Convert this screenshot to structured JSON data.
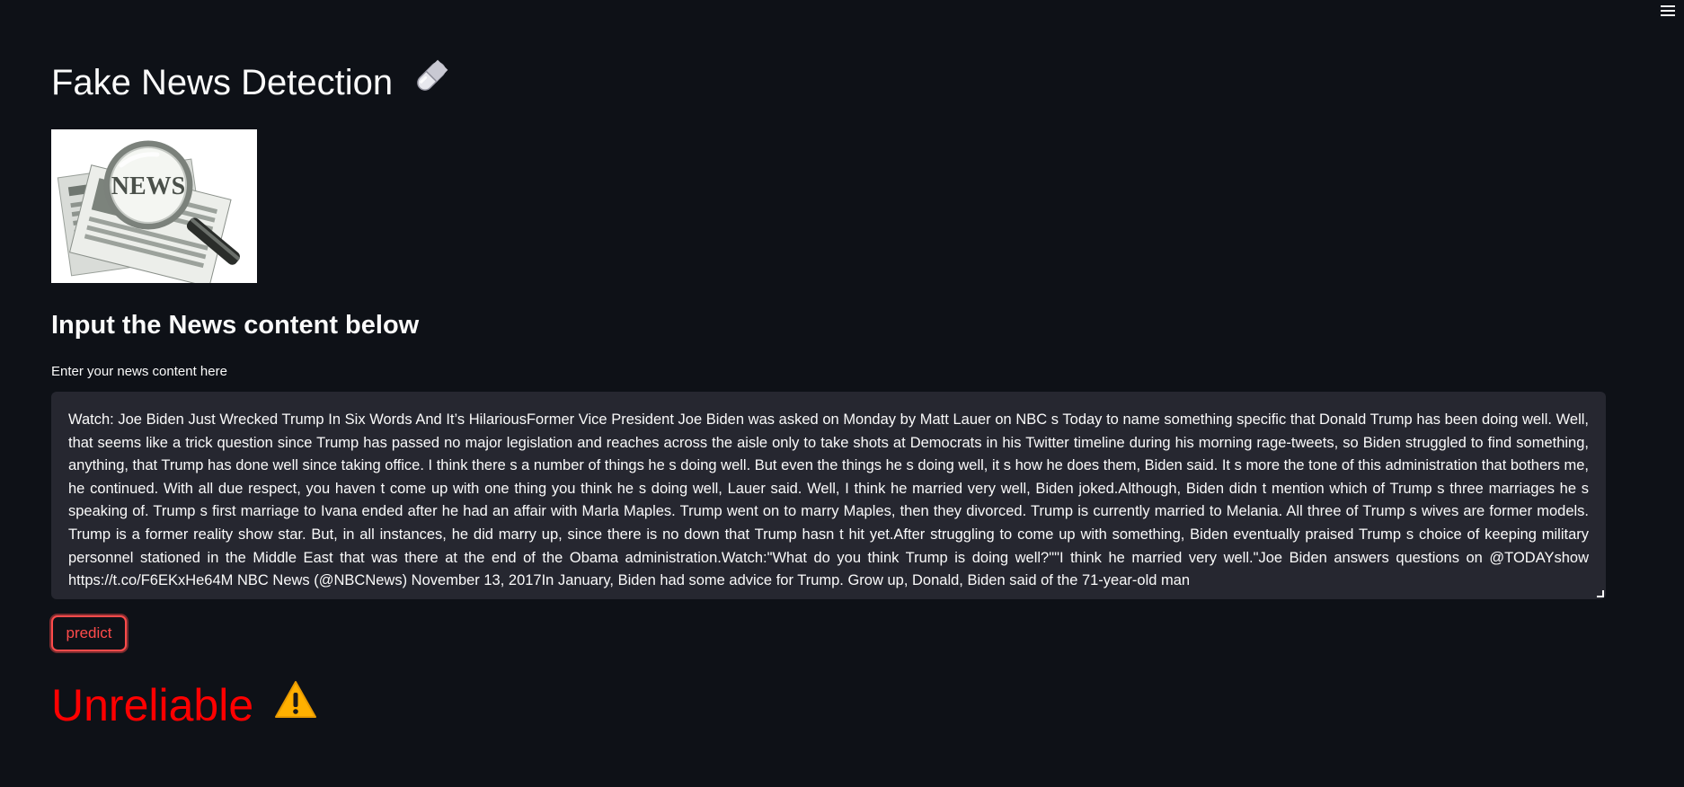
{
  "header": {
    "menu_icon": "hamburger-menu-icon"
  },
  "page": {
    "title": "Fake News Detection",
    "title_icon": "pill-emoji-icon",
    "image": {
      "name": "news-magnifier-image",
      "text": "NEWS"
    },
    "subtitle": "Input the News content below"
  },
  "input": {
    "label": "Enter your news content here",
    "value": " Watch: Joe Biden Just Wrecked Trump In Six Words And It’s HilariousFormer Vice President Joe Biden was asked on Monday by Matt Lauer on NBC s  Today  to name something specific that Donald Trump has been  doing well. Well, that seems like a trick question since Trump has passed no major legislation and reaches across the aisle only to take shots at Democrats in his Twitter timeline during his morning rage-tweets, so Biden struggled to find something, anything, that Trump has done well since taking office. I think there s a number of things he s doing well. But even the things he s doing well, it s how he does them,  Biden said. It s more the tone of this administration that bothers me,  he continued. With all due respect, you haven t come up with one thing you think he s doing well,  Lauer said. Well, I think he married very well,  Biden joked.Although, Biden didn t mention which of Trump s three marriages he s speaking of. Trump s first marriage to Ivana ended after he had an affair with Marla Maples. Trump went on to marry Maples, then they divorced. Trump is currently married to Melania. All three of Trump s wives are former models. Trump is a former reality show star. But, in all instances, he did marry up, since there is no  down  that Trump hasn t hit yet.After struggling to come up with something, Biden eventually praised Trump s choice of keeping military personnel stationed in the Middle East that was there at the end of the Obama administration.Watch:\"What do you think Trump is doing well?\"\"I think he married very well.\"Joe Biden answers questions on @TODAYshow https://t.co/F6EKxHe64M  NBC News (@NBCNews) November 13, 2017In January, Biden had some advice for Trump.  Grow up, Donald,  Biden said of the 71-year-old man"
  },
  "actions": {
    "predict_label": "predict"
  },
  "result": {
    "label": "Unreliable",
    "icon": "warning-sign-icon",
    "color": "#ff0000"
  },
  "colors": {
    "background": "#0e1117",
    "input_background": "#262730",
    "accent": "#ff4b4b",
    "text": "#fafafa"
  }
}
